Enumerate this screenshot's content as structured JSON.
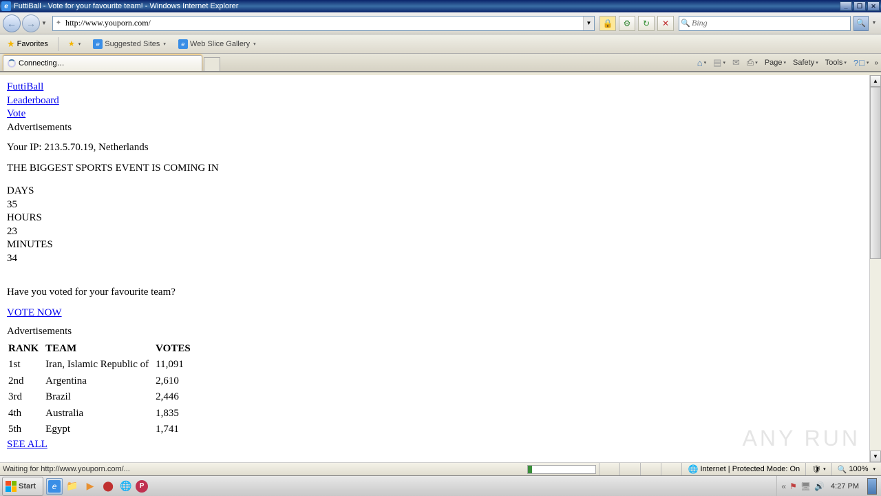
{
  "window": {
    "title": "FuttiBall - Vote for your favourite team! - Windows Internet Explorer"
  },
  "address": {
    "url": "http://www.youporn.com/"
  },
  "search": {
    "placeholder": "Bing"
  },
  "favorites": {
    "label": "Favorites",
    "suggested": "Suggested Sites",
    "webslice": "Web Slice Gallery"
  },
  "tab": {
    "label": "Connecting…"
  },
  "commands": {
    "page": "Page",
    "safety": "Safety",
    "tools": "Tools"
  },
  "page": {
    "nav": {
      "futtiball": "FuttiBall",
      "leaderboard": "Leaderboard",
      "vote": "Vote",
      "ads": "Advertisements"
    },
    "ip_line": "Your IP: 213.5.70.19, Netherlands",
    "headline": "THE BIGGEST SPORTS EVENT IS COMING IN",
    "countdown": {
      "days_label": "DAYS",
      "days": "35",
      "hours_label": "HOURS",
      "hours": "23",
      "minutes_label": "MINUTES",
      "minutes": "34"
    },
    "prompt": "Have you voted for your favourite team?",
    "vote_now": "VOTE NOW",
    "ads2": "Advertisements",
    "table": {
      "headers": {
        "rank": "RANK",
        "team": "TEAM",
        "votes": "VOTES"
      },
      "rows": [
        {
          "rank": "1st",
          "team": "Iran, Islamic Republic of",
          "votes": "11,091"
        },
        {
          "rank": "2nd",
          "team": "Argentina",
          "votes": "2,610"
        },
        {
          "rank": "3rd",
          "team": "Brazil",
          "votes": "2,446"
        },
        {
          "rank": "4th",
          "team": "Australia",
          "votes": "1,835"
        },
        {
          "rank": "5th",
          "team": "Egypt",
          "votes": "1,741"
        }
      ]
    },
    "see_all": "SEE ALL"
  },
  "status": {
    "left": "Waiting for http://www.youporn.com/...",
    "zone": "Internet | Protected Mode: On",
    "zoom": "100%"
  },
  "taskbar": {
    "start": "Start",
    "clock": "4:27 PM"
  },
  "watermark": "ANY    RUN"
}
